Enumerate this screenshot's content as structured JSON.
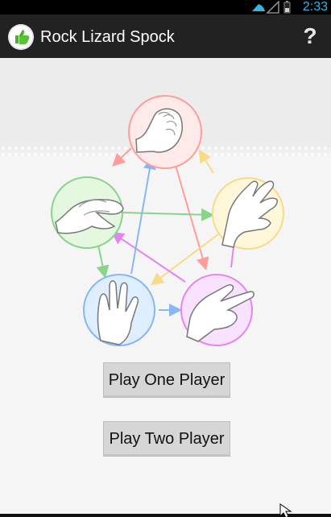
{
  "status_bar": {
    "time": "2:33",
    "icons": [
      "wifi-icon",
      "signal-icon",
      "battery-icon"
    ],
    "accent_color": "#33b5e5"
  },
  "app_bar": {
    "title": "Rock Lizard Spock",
    "app_icon": "thumbs-up-icon",
    "help_icon": "help-icon",
    "help_text": "?"
  },
  "diagram": {
    "gestures": [
      {
        "name": "rock",
        "icon": "rock-hand-icon",
        "color": "#ff9c9c"
      },
      {
        "name": "paper",
        "icon": "paper-hand-icon",
        "color": "#f7db86"
      },
      {
        "name": "scissors",
        "icon": "scissors-hand-icon",
        "color": "#e486f0"
      },
      {
        "name": "spock",
        "icon": "spock-hand-icon",
        "color": "#86b7f5"
      },
      {
        "name": "lizard",
        "icon": "lizard-hand-icon",
        "color": "#89d38c"
      }
    ],
    "arrow_colors": {
      "rock": "#ff9c9c",
      "paper": "#f7db86",
      "scissors": "#e486f0",
      "spock": "#86b7f5",
      "lizard": "#89d38c"
    }
  },
  "buttons": {
    "one_player": "Play One Player",
    "two_player": "Play Two Player"
  }
}
